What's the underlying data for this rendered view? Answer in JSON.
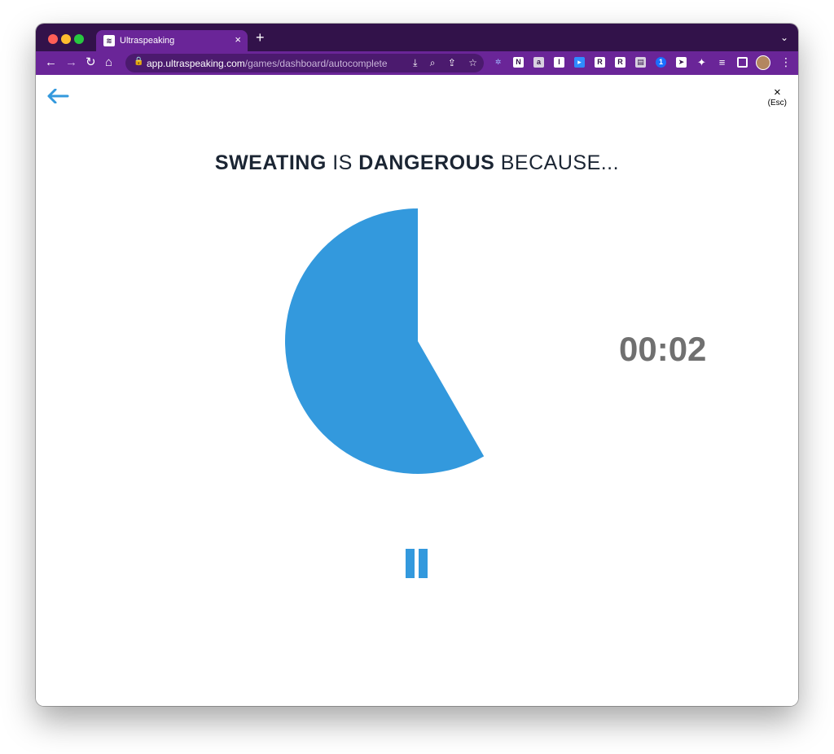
{
  "browser": {
    "tab_title": "Ultraspeaking",
    "tab_close": "×",
    "new_tab": "+",
    "tab_menu": "⌄",
    "url_host": "app.ultraspeaking.com",
    "url_path": "/games/dashboard/autocomplete",
    "extension_icons": [
      "gear-ext-icon",
      "notion-ext-icon",
      "ext-icon",
      "instapaper-ext-icon",
      "video-ext-icon",
      "readwise-ext-icon",
      "reader-ext-icon",
      "ext-icon",
      "onepassword-ext-icon",
      "send-ext-icon",
      "puzzle-ext-icon",
      "playlist-ext-icon",
      "sidepanel-ext-icon"
    ]
  },
  "game": {
    "esc_x": "×",
    "esc_label": "(Esc)",
    "prompt_word1": "SWEATING",
    "prompt_mid": " IS ",
    "prompt_word2": "DANGEROUS",
    "prompt_end": " BECAUSE...",
    "timer": "00:02",
    "timer_progress_fraction": 0.583,
    "accent_color": "#3399dd"
  }
}
